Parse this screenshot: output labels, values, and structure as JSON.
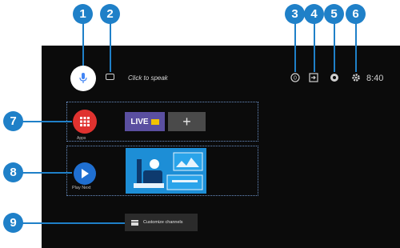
{
  "top_bar": {
    "voice_hint": "Click to speak",
    "clock": "8:40"
  },
  "apps_row": {
    "apps_label": "Apps",
    "live_tile_label": "LIVE",
    "add_tile_label": "+"
  },
  "play_next_row": {
    "label": "Play Next"
  },
  "customize": {
    "label": "Customize channels"
  },
  "callouts": [
    "1",
    "2",
    "3",
    "4",
    "5",
    "6",
    "7",
    "8",
    "9"
  ],
  "colors": {
    "callout": "#1f80c8",
    "apps": "#e0322f",
    "play_next": "#1f6fd1",
    "live_tile": "#5a4fa0",
    "screen_bg": "#0b0b0b"
  }
}
